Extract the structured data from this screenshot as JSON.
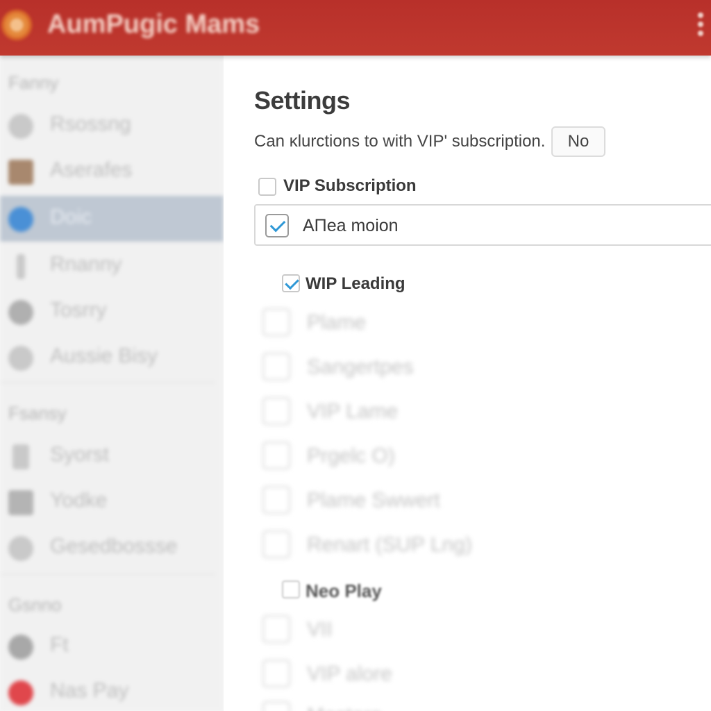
{
  "app": {
    "title": "AumPugic Mams",
    "logo_icon": "app-logo-icon",
    "menu_icon": "kebab-menu-icon",
    "accent_color": "#c0392f"
  },
  "sidebar": {
    "sections": [
      {
        "header": "Fanny",
        "items": [
          {
            "label": "Rsossng",
            "icon": "gear-icon"
          },
          {
            "label": "Aserafes",
            "icon": "photo-thumbnail-icon"
          },
          {
            "label": "Doic",
            "icon": "play-circle-icon",
            "active": true
          },
          {
            "label": "Rnanny",
            "icon": "info-icon"
          },
          {
            "label": "Tosrry",
            "icon": "chat-icon"
          },
          {
            "label": "Aussie Bisy",
            "icon": "filter-icon"
          }
        ]
      },
      {
        "header": "Fsansy",
        "items": [
          {
            "label": "Syorst",
            "icon": "list-icon"
          },
          {
            "label": "Yodke",
            "icon": "mail-icon"
          },
          {
            "label": "Gesedbossse",
            "icon": "user-icon"
          }
        ]
      },
      {
        "header": "Gsnno",
        "items": [
          {
            "label": "Ft",
            "icon": "circle-icon"
          },
          {
            "label": "Nas Pay",
            "icon": "record-icon"
          }
        ]
      }
    ]
  },
  "settings": {
    "title": "Settings",
    "question": "Can ĸlurctions to with VIP' subscription.",
    "no_button": "No",
    "vip_subscription": {
      "label": "VIP Subscription",
      "checked": false
    },
    "area_motion": {
      "value": "AΠea moion",
      "checked": true
    },
    "wip_leading": {
      "label": "WIP Leading",
      "checked": true
    },
    "options": [
      {
        "label": "Plame",
        "checked": false
      },
      {
        "label": "Sangertpes",
        "checked": false
      },
      {
        "label": "VIP Lame",
        "checked": false
      },
      {
        "label": "Prgelc O)",
        "checked": false
      },
      {
        "label": "Plame Swwert",
        "checked": false
      },
      {
        "label": "Renart (SUP Lng)",
        "checked": false
      }
    ],
    "no_play": {
      "label": "Neo Play",
      "checked": false
    },
    "more_options": [
      {
        "label": "VII",
        "checked": false
      },
      {
        "label": "VIP alore",
        "checked": false
      },
      {
        "label": "Mastare",
        "checked": false
      }
    ]
  }
}
